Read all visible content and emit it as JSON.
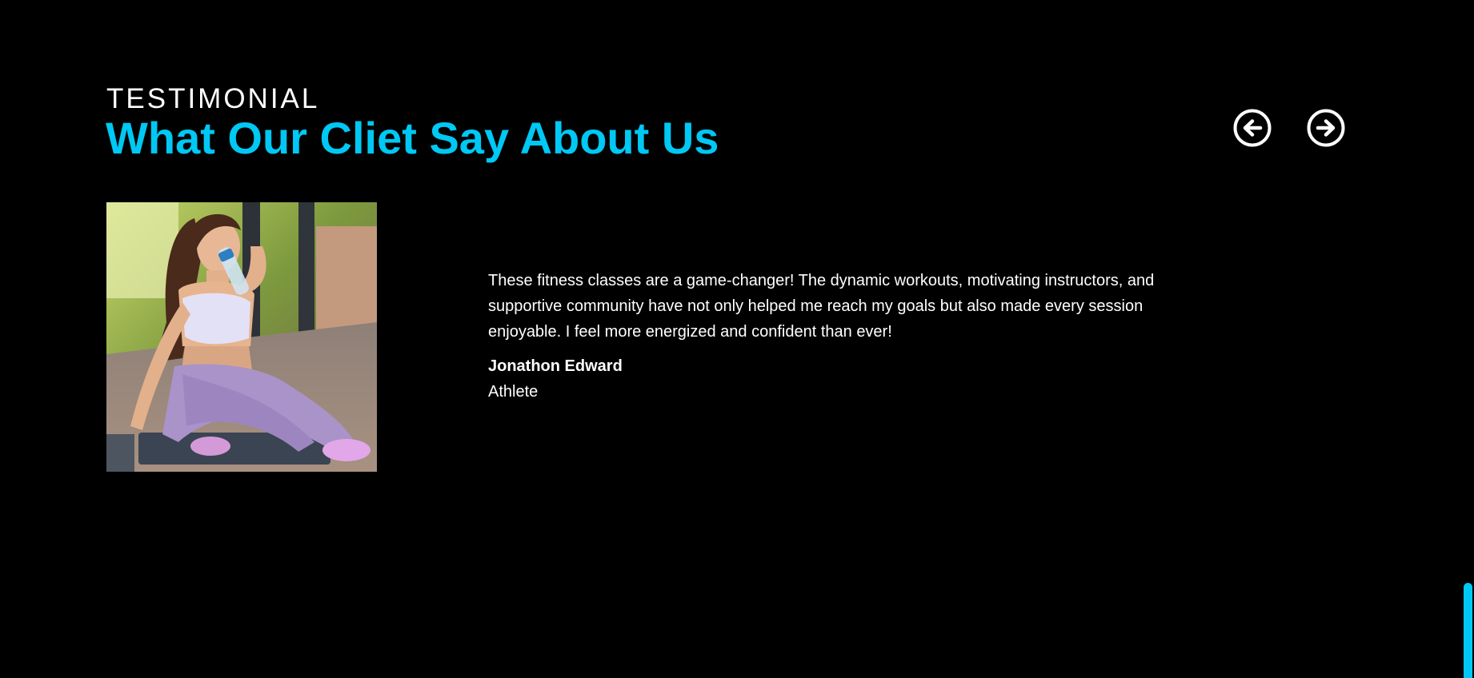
{
  "section": {
    "eyebrow": "TESTIMONIAL",
    "title": "What Our Cliet Say About Us"
  },
  "nav": {
    "prev_icon": "arrow-left-circle-icon",
    "next_icon": "arrow-right-circle-icon"
  },
  "testimonial": {
    "photo": "woman-drinking-water-photo",
    "quote": "These fitness classes are a game-changer! The dynamic workouts, motivating instructors, and supportive community have not only helped me reach my goals but also made every session enjoyable. I feel more energized and confident than ever!",
    "author_name": "Jonathon Edward",
    "author_role": "Athlete"
  },
  "colors": {
    "background": "#000000",
    "accent": "#00c8f4",
    "text": "#ffffff"
  }
}
